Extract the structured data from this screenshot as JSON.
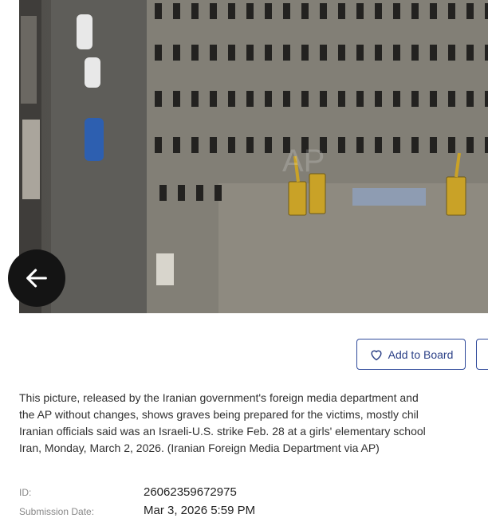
{
  "photo": {
    "alt": "",
    "watermark": "AP",
    "colors": {
      "ground": "#8c897f",
      "street": "#5a5955",
      "excavator": "#c9a227"
    }
  },
  "nav": {
    "back_icon": "arrow-left-icon"
  },
  "actions": {
    "add_to_board_label": "Add to Board",
    "add_to_board_icon": "heart-icon"
  },
  "caption": {
    "lines": [
      "This picture, released by the Iranian government's foreign media department and",
      "the AP without changes, shows graves being prepared for the victims, mostly chil",
      "Iranian officials said was an Israeli-U.S. strike Feb. 28 at a girls' elementary school",
      "Iran, Monday, March 2, 2026. (Iranian Foreign Media Department via AP)"
    ]
  },
  "details": {
    "id_label": "ID:",
    "id_value": "26062359672975",
    "submission_label": "Submission Date:",
    "submission_value": "Mar 3, 2026 5:59 PM"
  }
}
